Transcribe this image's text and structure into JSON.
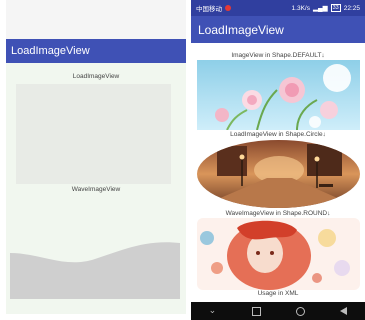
{
  "left_screen": {
    "app_title": "LoadImageView",
    "load_image_label": "LoadImageView",
    "wave_image_label": "WaveImageView"
  },
  "right_screen": {
    "status": {
      "carrier": "中国移动",
      "speed": "1.3K/s",
      "battery": "33",
      "time": "22:25"
    },
    "app_title": "LoadImageView",
    "captions": {
      "default_shape": "ImageView in Shape.DEFAULT↓",
      "circle_shape": "LoadImageView in Shape.Circle↓",
      "round_shape": "WaveImageView in Shape.ROUND↓",
      "xml_usage": "Usage in XML"
    },
    "nav_icons": [
      "chevron-down-icon",
      "square-icon",
      "circle-icon",
      "back-icon"
    ]
  },
  "colors": {
    "primary": "#3f51b5",
    "primary_dark": "#303f9f",
    "placeholder": "#cfcfcf"
  }
}
